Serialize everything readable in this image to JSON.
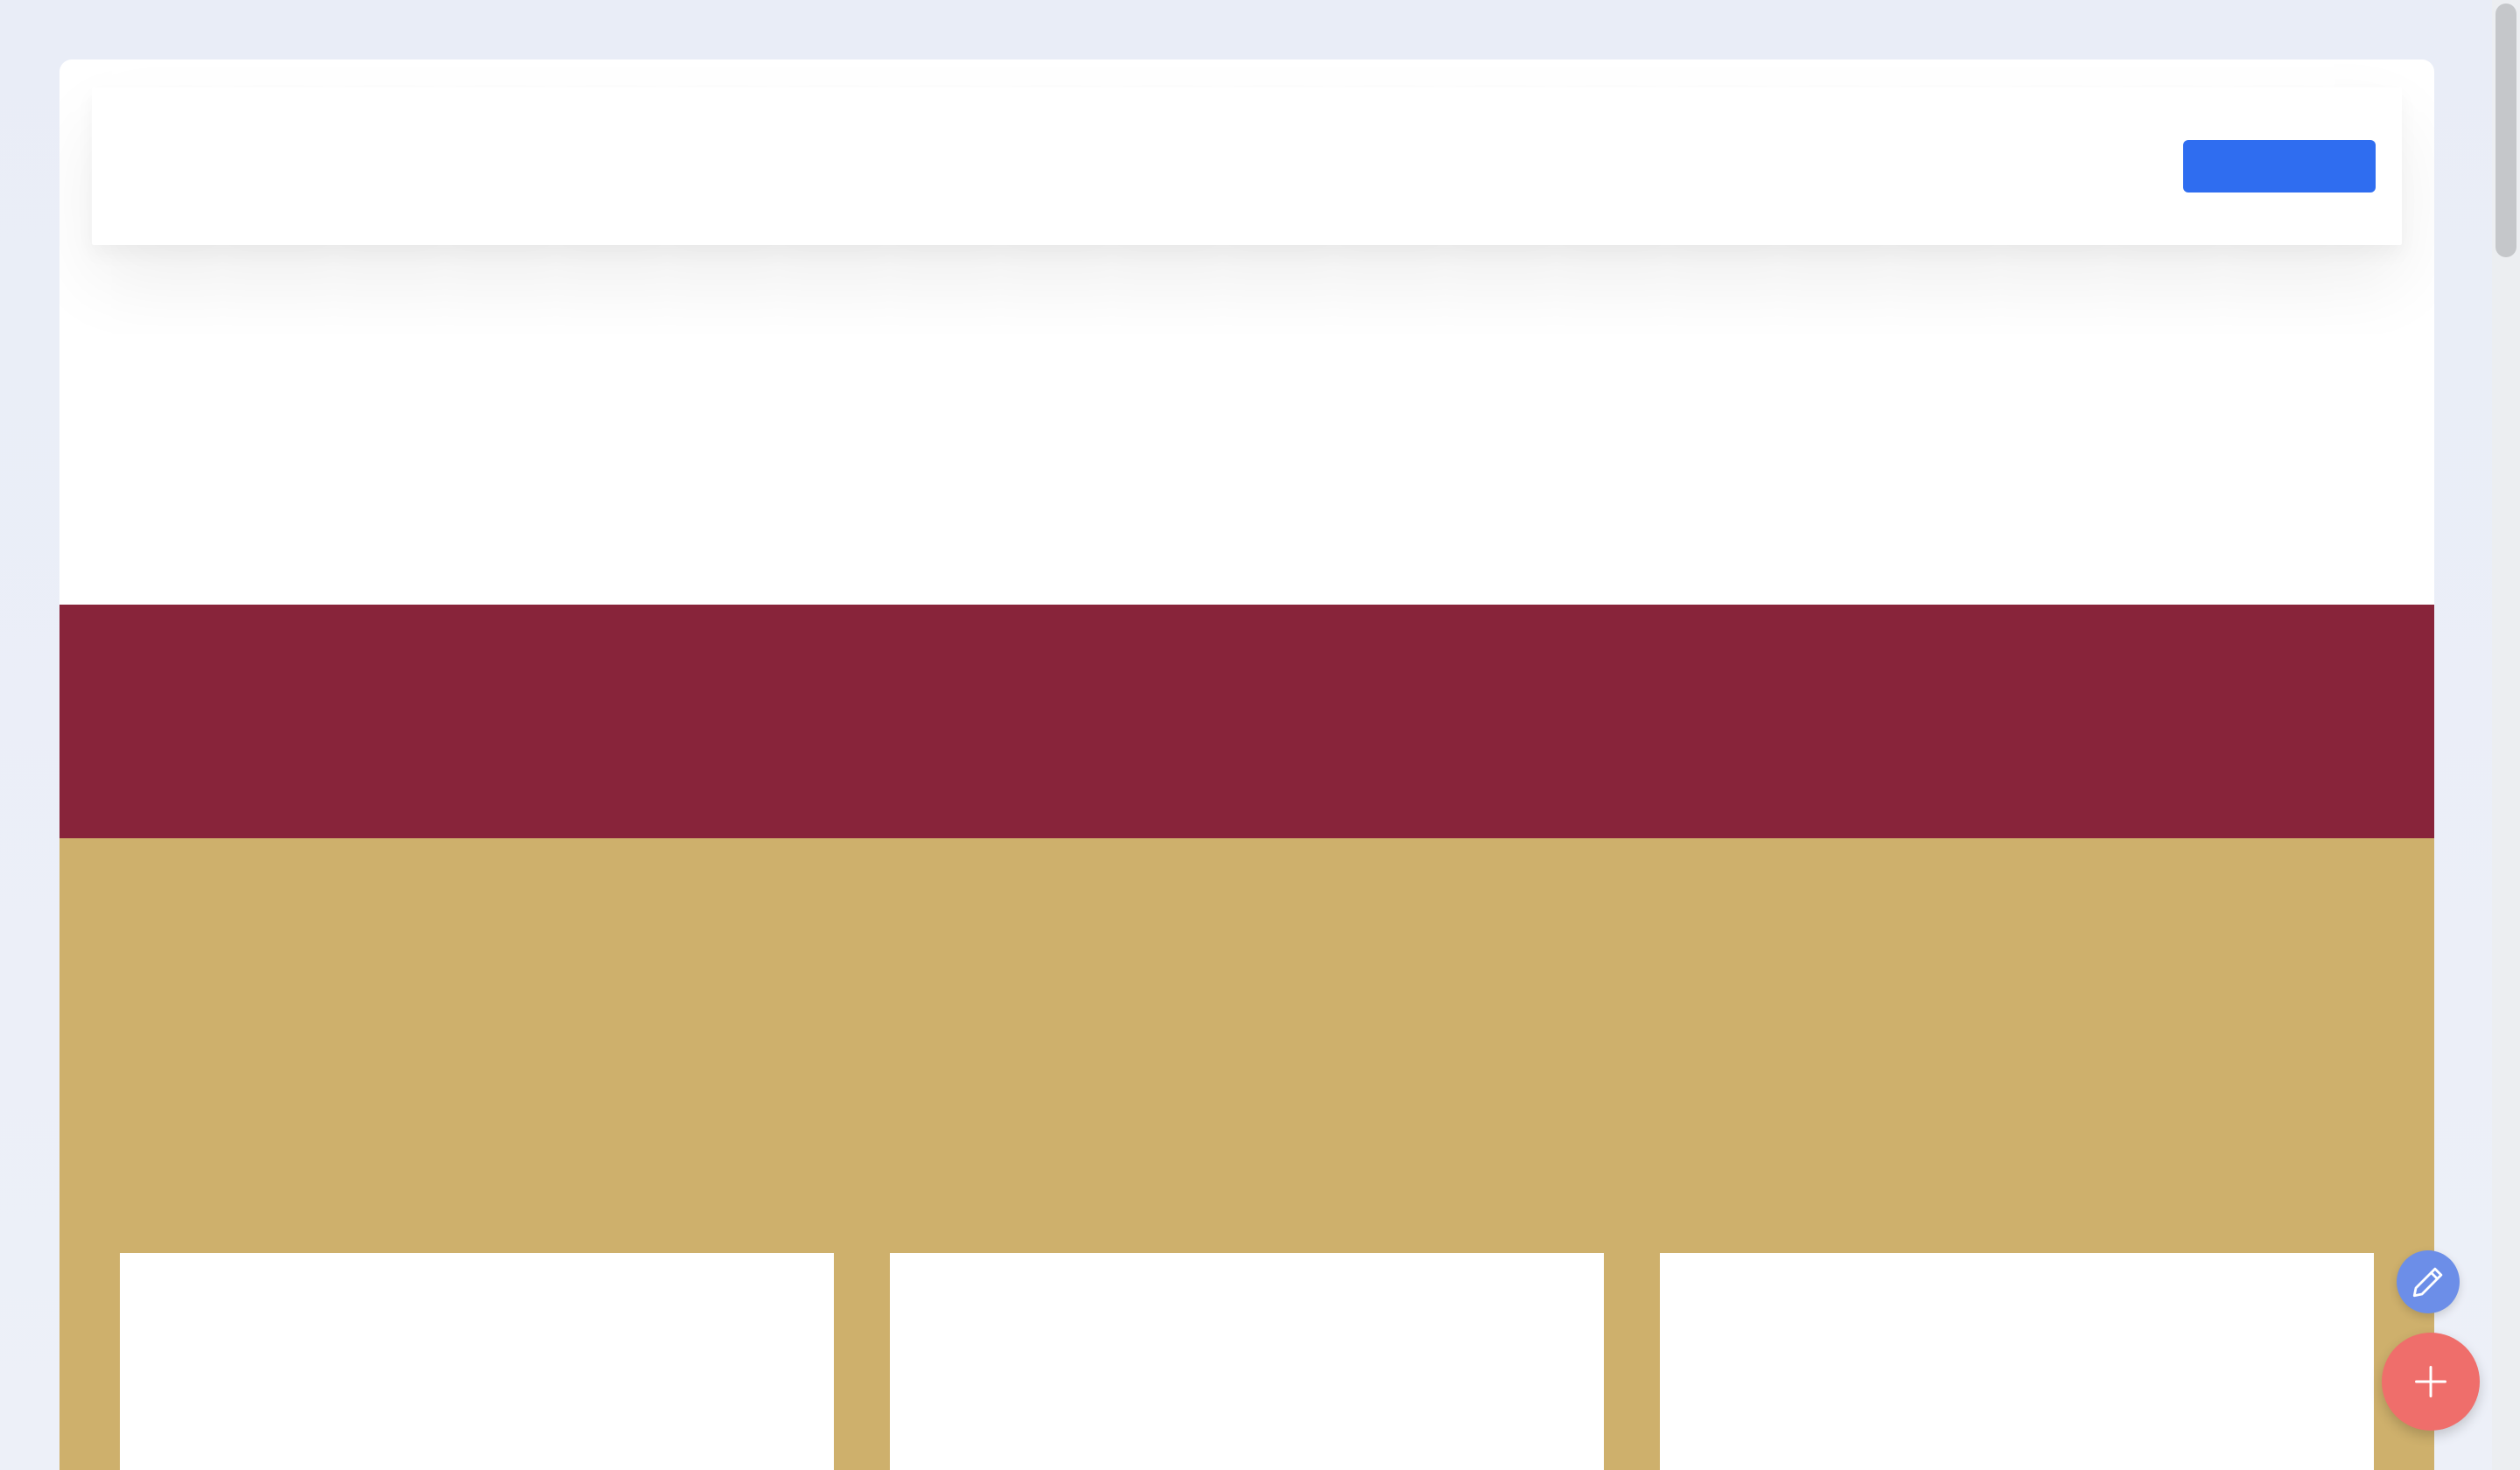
{
  "header": {
    "cta_label": ""
  },
  "colors": {
    "background": "#e9edf6",
    "canvas": "#ffffff",
    "cta_blue": "#2f6df0",
    "band_crimson": "#88243a",
    "band_gold": "#ceb06c",
    "fab_edit": "#6c8ee8",
    "fab_add": "#ef6e6b",
    "scrollbar_thumb": "#c5c7ca"
  },
  "floating_actions": {
    "edit_icon": "pencil-icon",
    "add_icon": "plus-icon"
  },
  "cards": [
    {
      "name": "card-1"
    },
    {
      "name": "card-2"
    },
    {
      "name": "card-3"
    }
  ]
}
